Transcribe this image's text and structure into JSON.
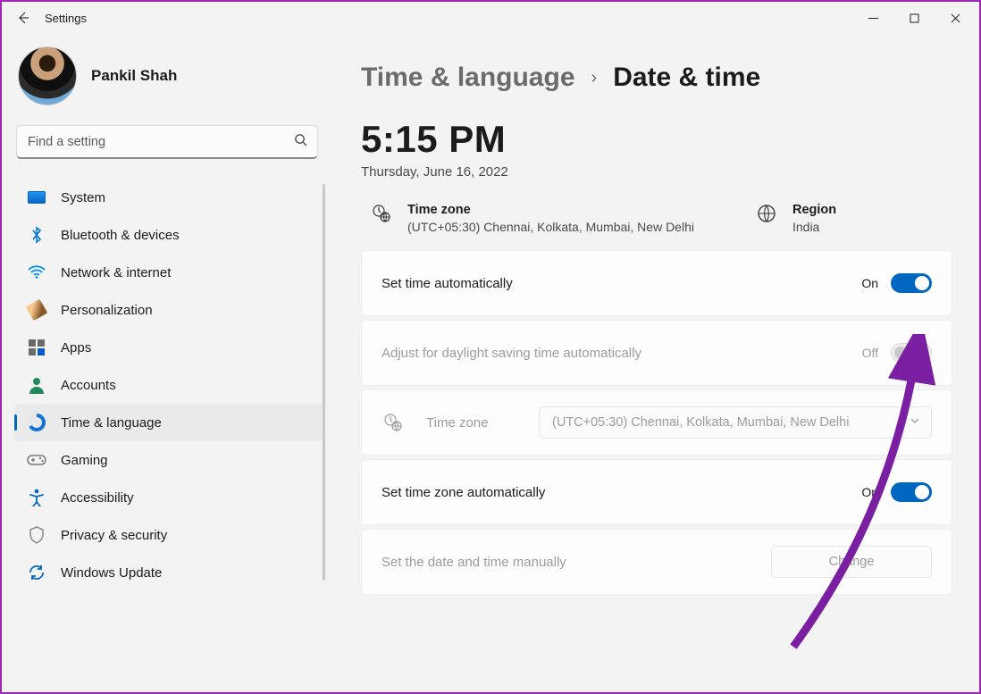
{
  "window": {
    "title": "Settings"
  },
  "profile": {
    "name": "Pankil Shah"
  },
  "search": {
    "placeholder": "Find a setting"
  },
  "nav": {
    "items": [
      {
        "label": "System"
      },
      {
        "label": "Bluetooth & devices"
      },
      {
        "label": "Network & internet"
      },
      {
        "label": "Personalization"
      },
      {
        "label": "Apps"
      },
      {
        "label": "Accounts"
      },
      {
        "label": "Time & language"
      },
      {
        "label": "Gaming"
      },
      {
        "label": "Accessibility"
      },
      {
        "label": "Privacy & security"
      },
      {
        "label": "Windows Update"
      }
    ]
  },
  "breadcrumb": {
    "parent": "Time & language",
    "current": "Date & time"
  },
  "clock": {
    "time": "5:15 PM",
    "date": "Thursday, June 16, 2022"
  },
  "info": {
    "timezone": {
      "label": "Time zone",
      "value": "(UTC+05:30) Chennai, Kolkata, Mumbai, New Delhi"
    },
    "region": {
      "label": "Region",
      "value": "India"
    }
  },
  "settings": {
    "set_time_auto": {
      "label": "Set time automatically",
      "state": "On"
    },
    "dst_auto": {
      "label": "Adjust for daylight saving time automatically",
      "state": "Off"
    },
    "timezone_row": {
      "label": "Time zone",
      "select_value": "(UTC+05:30) Chennai, Kolkata, Mumbai, New Delhi"
    },
    "set_tz_auto": {
      "label": "Set time zone automatically",
      "state": "On"
    },
    "manual": {
      "label": "Set the date and time manually",
      "button": "Change"
    }
  }
}
